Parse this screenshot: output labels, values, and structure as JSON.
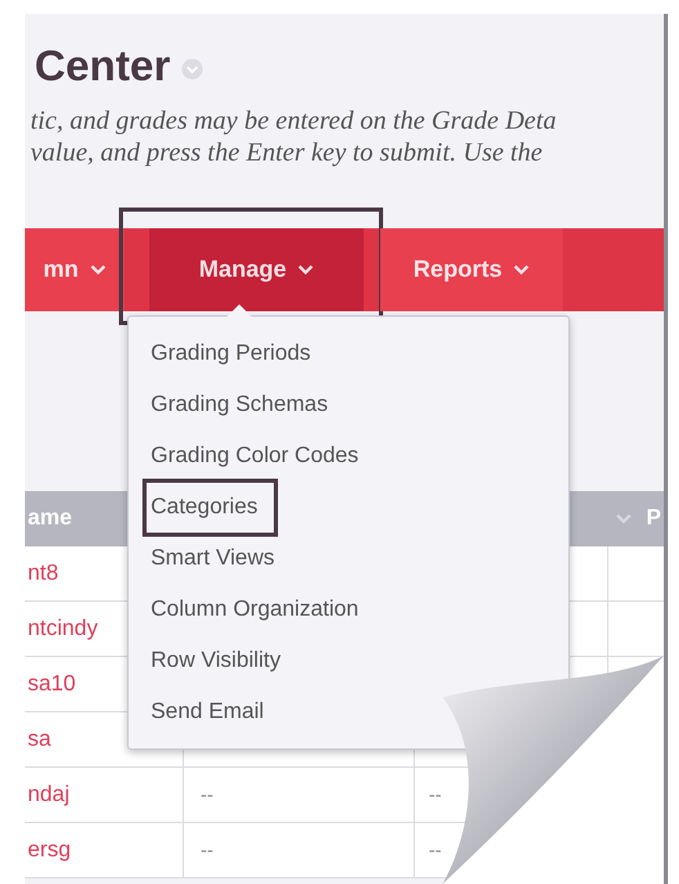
{
  "page": {
    "title": "Center",
    "description": [
      "tic, and grades may be entered on the Grade Deta",
      "value, and press the Enter key to submit. Use the"
    ]
  },
  "nav": [
    {
      "label": "mn",
      "selected": false,
      "outlined": false
    },
    {
      "label": "Manage",
      "selected": true,
      "outlined": true
    },
    {
      "label": "Reports",
      "selected": false,
      "outlined": false
    }
  ],
  "menu": {
    "items": [
      {
        "label": "Grading Periods",
        "outlined": false
      },
      {
        "label": "Grading Schemas",
        "outlined": false
      },
      {
        "label": "Grading Color Codes",
        "outlined": false
      },
      {
        "label": "Categories",
        "outlined": true
      },
      {
        "label": "Smart Views",
        "outlined": false
      },
      {
        "label": "Column Organization",
        "outlined": false
      },
      {
        "label": "Row Visibility",
        "outlined": false
      },
      {
        "label": "Send Email",
        "outlined": false
      }
    ]
  },
  "table": {
    "columns": [
      "ame",
      "P"
    ],
    "rows": [
      {
        "name": "nt8"
      },
      {
        "name": "ntcindy"
      },
      {
        "name": "sa10"
      },
      {
        "name": "sa"
      },
      {
        "name": "ndaj",
        "cells": [
          "--",
          "--"
        ]
      },
      {
        "name": "ersg",
        "cells": [
          "--",
          "--"
        ]
      }
    ]
  }
}
